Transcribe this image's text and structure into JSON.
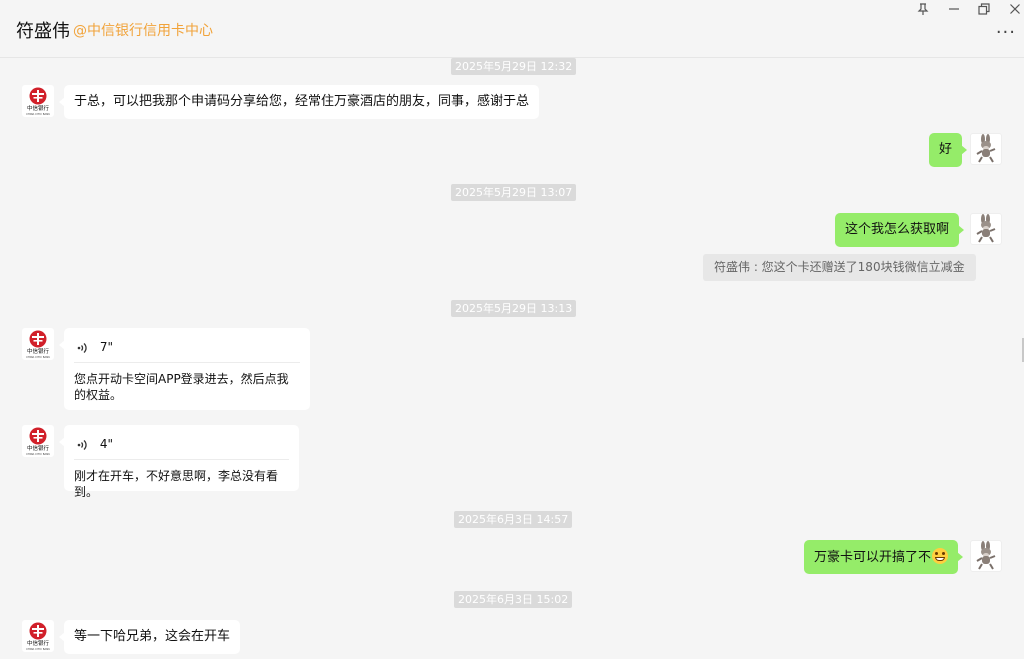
{
  "header": {
    "contact_name": "符盛伟",
    "contact_org": "@中信银行信用卡中心",
    "more_label": "···"
  },
  "window_controls": [
    {
      "name": "pin-icon",
      "glyph": "⊥"
    },
    {
      "name": "minimize-icon",
      "glyph": "—"
    },
    {
      "name": "restore-icon",
      "glyph": "❐"
    },
    {
      "name": "close-icon",
      "glyph": "✕"
    }
  ],
  "timestamps": [
    "2025年5月29日 12:32",
    "2025年5月29日 13:07",
    "2025年5月29日 13:13",
    "2025年6月3日 14:57",
    "2025年6月3日 15:02"
  ],
  "messages": {
    "m1": "于总，可以把我那个申请码分享给您，经常住万豪酒店的朋友，同事，感谢于总",
    "m2": "好",
    "m3": "这个我怎么获取啊",
    "m3_quote": "符盛伟 : 您这个卡还赠送了180块钱微信立减金",
    "v1_duration": "7\"",
    "v1_text": "您点开动卡空间APP登录进去，然后点我的权益。",
    "v2_duration": "4\"",
    "v2_text": "刚才在开车，不好意思啊，李总没有看到。",
    "m4": "万豪卡可以开搞了不",
    "m5": "等一下哈兄弟，这会在开车"
  },
  "avatar_bank": {
    "line1": "中信银行",
    "line2": "CHINA CITIC BANK",
    "color": "#d1202a"
  },
  "colors": {
    "bubble_out": "#95ec69",
    "bubble_in": "#ffffff",
    "org": "#f1a33a",
    "background": "#f5f5f5"
  }
}
